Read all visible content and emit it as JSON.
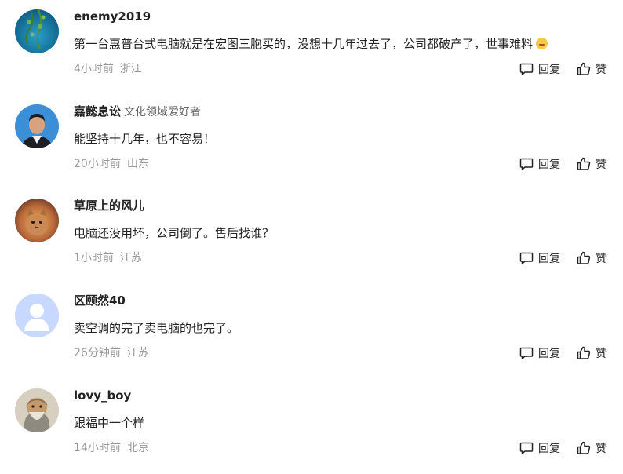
{
  "actions": {
    "reply_label": "回复",
    "like_label": "赞"
  },
  "comments": [
    {
      "username": "enemy2019",
      "badge": "",
      "text": "第一台惠普台式电脑就是在宏图三胞买的，没想十几年过去了，公司都破产了，世事难料",
      "emoji": "laughing-crying-emoji-icon",
      "time": "4小时前",
      "location": "浙江"
    },
    {
      "username": "嘉懿息讼",
      "badge": "文化领域爱好者",
      "text": "能坚持十几年，也不容易！",
      "time": "20小时前",
      "location": "山东"
    },
    {
      "username": "草原上的风儿",
      "badge": "",
      "text": "电脑还没用坏，公司倒了。售后找谁？",
      "time": "1小时前",
      "location": "江苏"
    },
    {
      "username": "区颐然40",
      "badge": "",
      "text": "卖空调的完了卖电脑的也完了。",
      "time": "26分钟前",
      "location": "江苏"
    },
    {
      "username": "lovy_boy",
      "badge": "",
      "text": "跟福中一个样",
      "time": "14小时前",
      "location": "北京"
    }
  ],
  "colors": {
    "username": "#222222",
    "meta": "#999999",
    "badge": "#666666"
  }
}
